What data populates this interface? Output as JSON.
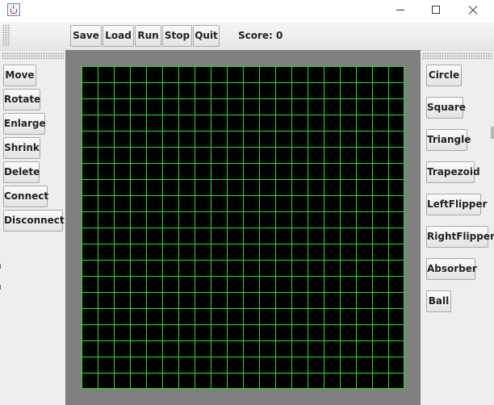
{
  "window": {
    "title": "",
    "app_icon": "java-cup-icon",
    "controls": {
      "minimize_icon": "minimize-icon",
      "maximize_icon": "maximize-icon",
      "close_icon": "close-icon"
    }
  },
  "toolbar": {
    "save": "Save",
    "load": "Load",
    "run": "Run",
    "stop": "Stop",
    "quit": "Quit",
    "score": "Score: 0"
  },
  "left_panel": {
    "buttons": [
      "Move",
      "Rotate",
      "Enlarge",
      "Shrink",
      "Delete",
      "Connect",
      "Disconnect"
    ]
  },
  "right_panel": {
    "buttons": [
      "Circle",
      "Square",
      "Triangle",
      "Trapezoid",
      "LeftFlipper",
      "RightFlipper",
      "Absorber",
      "Ball"
    ]
  },
  "board": {
    "columns": 20,
    "rows": 20,
    "background_color": "#000000",
    "grid_color": "#1fe61f",
    "frame_color": "#808080"
  }
}
